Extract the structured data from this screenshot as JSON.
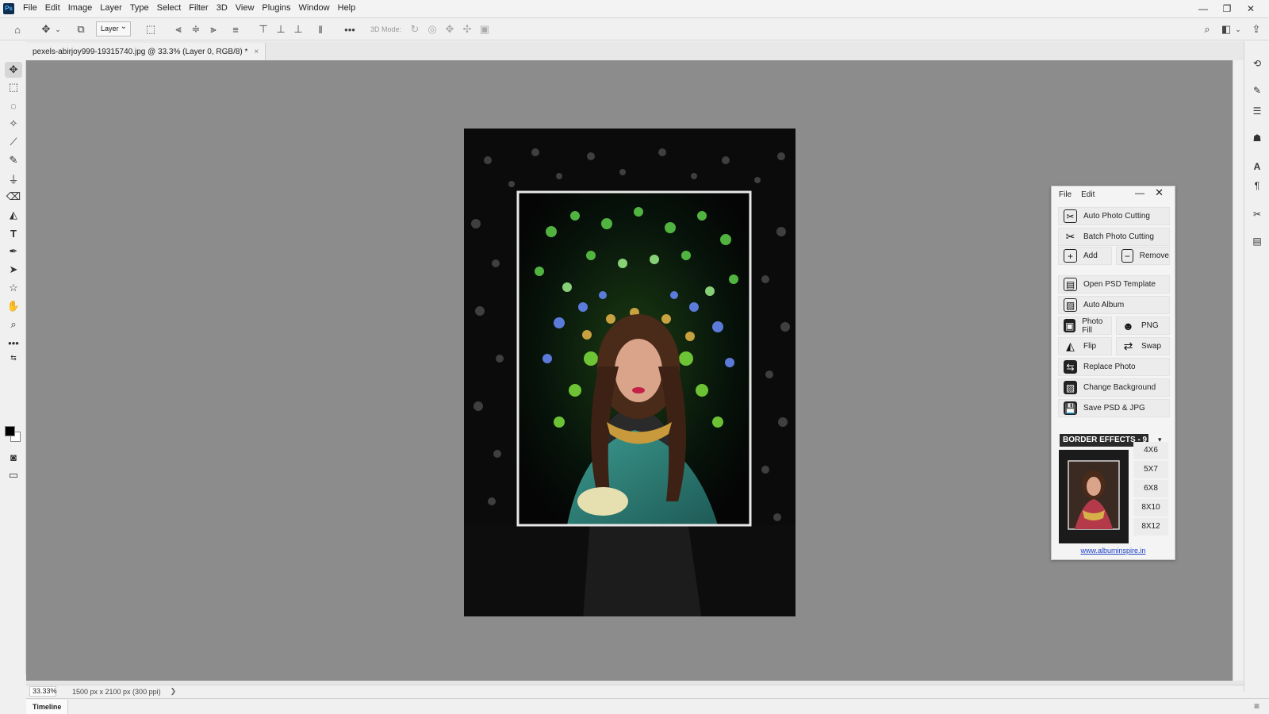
{
  "app": {
    "name": "Photoshop",
    "logo_text": "Ps"
  },
  "menu": [
    "File",
    "Edit",
    "Image",
    "Layer",
    "Type",
    "Select",
    "Filter",
    "3D",
    "View",
    "Plugins",
    "Window",
    "Help"
  ],
  "window_controls": {
    "minimize": "—",
    "restore": "❐",
    "close": "✕"
  },
  "options_bar": {
    "layer_select": "Layer",
    "mode_label": "3D Mode:"
  },
  "document": {
    "tab_title": "pexels-abirjoy999-19315740.jpg @ 33.3% (Layer 0, RGB/8) *",
    "tab_close": "×"
  },
  "status": {
    "zoom": "33.33%",
    "doc_info": "1500 px x 2100 px (300 ppi)",
    "arrow": "❯"
  },
  "timeline": {
    "label": "Timeline",
    "menu_icon": "≡"
  },
  "plugin": {
    "menu_file": "File",
    "menu_edit": "Edit",
    "minimize": "—",
    "close": "✕",
    "buttons": {
      "auto_photo_cutting": "Auto Photo Cutting",
      "batch_photo_cutting": "Batch Photo Cutting",
      "add": "Add",
      "remove": "Remove",
      "open_psd_template": "Open PSD Template",
      "auto_album": "Auto Album",
      "photo_fill": "Photo Fill",
      "png": "PNG",
      "flip": "Flip",
      "swap": "Swap",
      "replace_photo": "Replace Photo",
      "change_background": "Change Background",
      "save_psd_jpg": "Save PSD & JPG"
    },
    "border_effects": "BORDER EFFECTS - 9",
    "sizes": [
      "4X6",
      "5X7",
      "6X8",
      "8X10",
      "8X12"
    ],
    "link": "www.albuminspire.in"
  },
  "colors": {
    "canvas_bg": "#8c8c8c",
    "chrome": "#f0f0f0",
    "photo_dark": "#0a0a0a",
    "dress_teal": "#2f7f78",
    "link_blue": "#1a3fc4"
  }
}
